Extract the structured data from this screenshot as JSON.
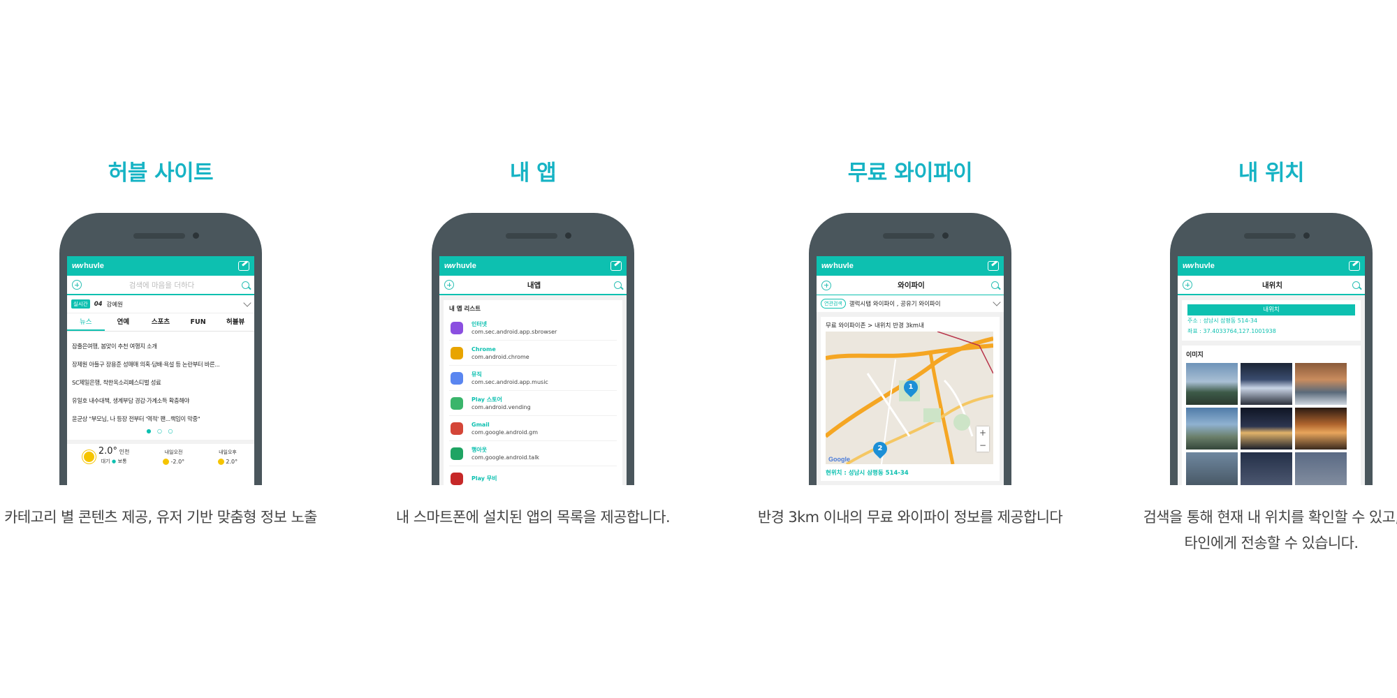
{
  "features": [
    {
      "title": "허블 사이트",
      "description": "카테고리 별 콘텐츠 제공, 유저 기반 맞춤형 정보 노출",
      "screen": {
        "logo": "huvle",
        "search_placeholder": "검색에 마음을 더하다",
        "realtime": {
          "badge": "실시간",
          "rank": "04",
          "keyword": "강예원"
        },
        "tabs": [
          "뉴스",
          "연예",
          "스포츠",
          "FUN",
          "허블뷰"
        ],
        "news": [
          "잠줄은여행, 봄맞이 추천 여행지 소개",
          "장제원 아들구 장용준 성매매 의혹·담배·욕설 등 논란부터 바른...",
          "SC제일은행, 착한옥소리페스티벌 성료",
          "유일호 내수대책, 생계부담 경감·가계소득 확충해야",
          "윤균상 \"부모님, 나 등장 전부터 '역적' 팬...책임이 막중\""
        ],
        "page_dots": "● ○ ○",
        "weather": {
          "now_temp": "2.0°",
          "city": "인천",
          "air": "대기",
          "air_status": "보통",
          "am_label": "내일오전",
          "am_temp": "-2.0°",
          "pm_label": "내일오후",
          "pm_temp": "2.0°"
        }
      }
    },
    {
      "title": "내 앱",
      "description": "내 스마트폰에 설치된 앱의 목록을 제공합니다.",
      "screen": {
        "logo": "huvle",
        "header_title": "내앱",
        "list_title": "내 앱 리스트",
        "apps": [
          {
            "name": "인터넷",
            "package": "com.sec.android.app.sbrowser",
            "icon": "internet-icon",
            "color": "#8b4fe0"
          },
          {
            "name": "Chrome",
            "package": "com.android.chrome",
            "icon": "chrome-icon",
            "color": "#e8a400"
          },
          {
            "name": "뮤직",
            "package": "com.sec.android.app.music",
            "icon": "music-icon",
            "color": "#5a86f0"
          },
          {
            "name": "Play 스토어",
            "package": "com.android.vending",
            "icon": "play-store-icon",
            "color": "#3ab56b"
          },
          {
            "name": "Gmail",
            "package": "com.google.android.gm",
            "icon": "gmail-icon",
            "color": "#d44638"
          },
          {
            "name": "행아웃",
            "package": "com.google.android.talk",
            "icon": "hangouts-icon",
            "color": "#1fa463"
          },
          {
            "name": "Play 무비",
            "package": "",
            "icon": "play-movies-icon",
            "color": "#c62828"
          }
        ]
      }
    },
    {
      "title": "무료 와이파이",
      "description": "반경 3km 이내의 무료 와이파이 정보를 제공합니다",
      "screen": {
        "logo": "huvle",
        "header_title": "와이파이",
        "related_badge": "연관검색",
        "related_text": "갤럭시탭 와이파이 , 공유기 와이파이",
        "map_title": "무료 와이파이존 > 내위치 반경 3km내",
        "current_location": "현위치 : 성남시 삼평동 514-34",
        "pins": [
          "1",
          "2"
        ]
      }
    },
    {
      "title": "내 위치",
      "description_line1": "검색을 통해 현재 내 위치를 확인할 수 있고,",
      "description_line2": "타인에게 전송할 수 있습니다.",
      "screen": {
        "logo": "huvle",
        "header_title": "내위치",
        "position_title": "내위치",
        "address": "주소 : 성남시 삼평동 514-34",
        "coords": "좌표 : 37.4033764,127.1001938",
        "image_title": "이미지"
      }
    }
  ]
}
